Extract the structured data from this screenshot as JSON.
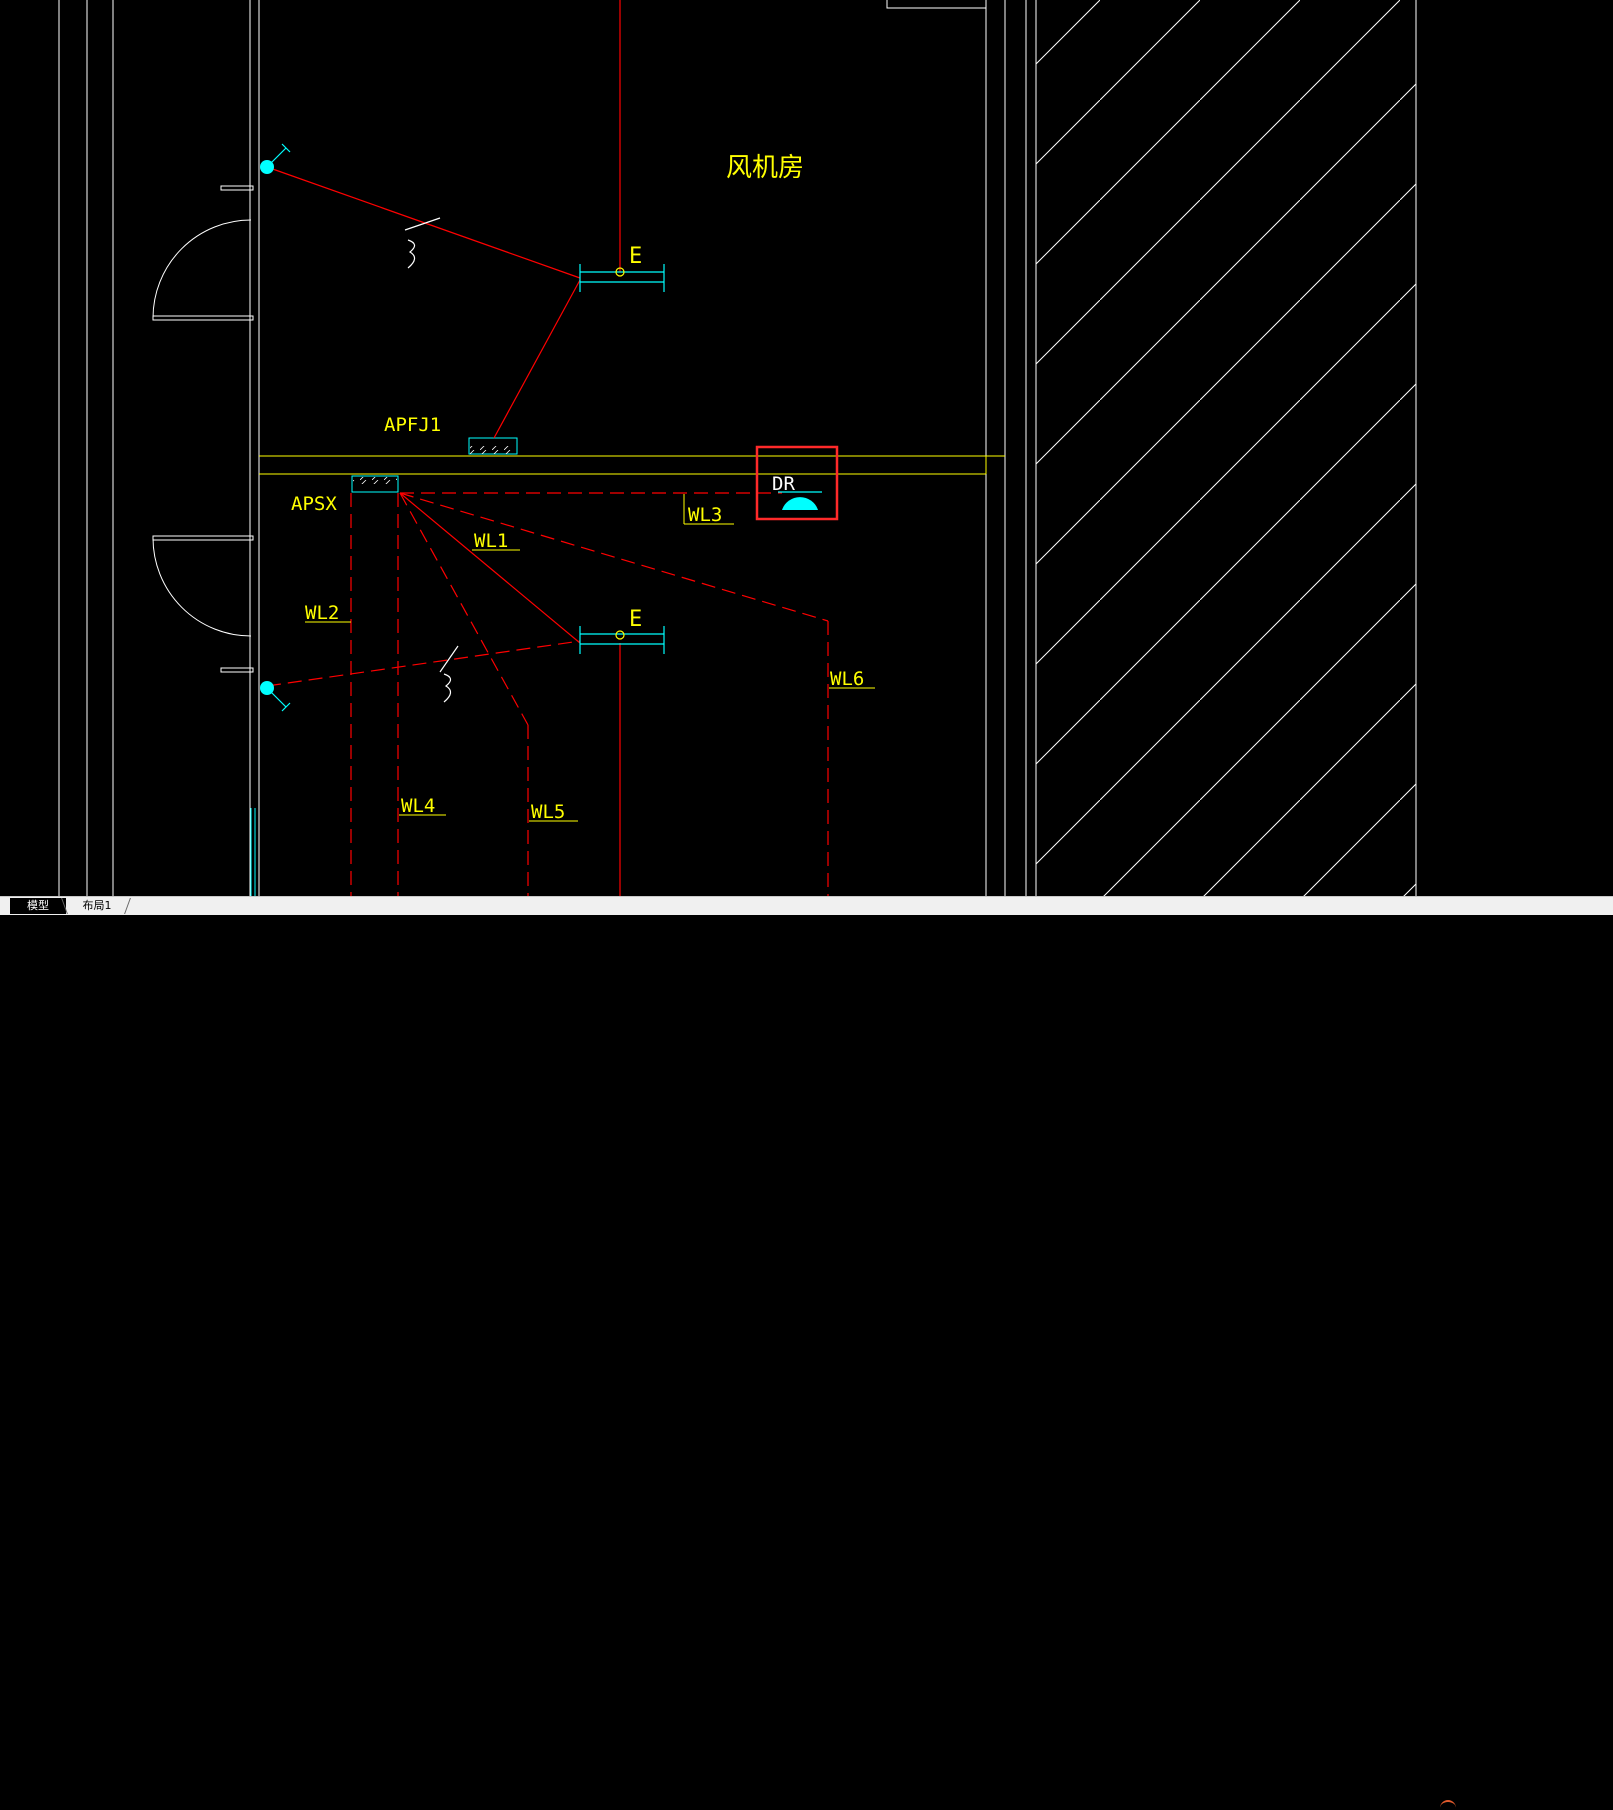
{
  "drawing": {
    "room_label": "风机房",
    "panels": {
      "upper": "APFJ1",
      "lower": "APSX"
    },
    "fixtures": {
      "upper_lamp": "E",
      "lower_lamp": "E",
      "highlighted_device": "DR"
    },
    "circuits": [
      "WL1",
      "WL2",
      "WL3",
      "WL4",
      "WL5",
      "WL6"
    ],
    "colors": {
      "background": "#000000",
      "wall": "#ffffff",
      "wire": "#ff0000",
      "label": "#ffff00",
      "fixture": "#00ffff",
      "highlight": "#ff2a2a"
    }
  },
  "tabs": {
    "model": "模型",
    "layout1": "布局1"
  }
}
